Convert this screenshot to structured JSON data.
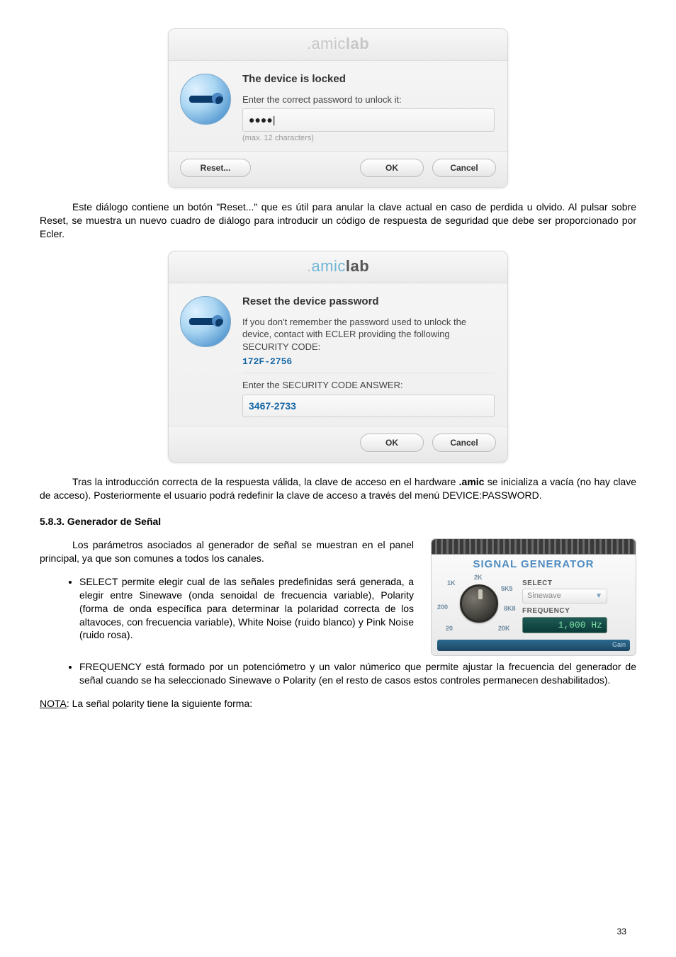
{
  "dialog1": {
    "brand_pre": ".",
    "brand_mid": "amic",
    "brand_post": "lab",
    "title": "The device is locked",
    "prompt": "Enter the correct password to unlock it:",
    "input_value": "●●●●|",
    "hint": "(max. 12 characters)",
    "reset_btn": "Reset...",
    "ok_btn": "OK",
    "cancel_btn": "Cancel"
  },
  "para1": "Este diálogo contiene un botón \"Reset...\" que es útil para anular la clave actual en caso de perdida u olvido. Al pulsar sobre Reset, se muestra un nuevo cuadro de diálogo para introducir un código de respuesta de seguridad que debe ser proporcionado por Ecler.",
  "dialog2": {
    "brand_pre": ".",
    "brand_mid": "amic",
    "brand_post": "lab",
    "title": "Reset the device password",
    "line1": "If you don't remember the password used to unlock the device, contact with ECLER providing the following SECURITY CODE:",
    "code1": "172F-2756",
    "line2": "Enter the SECURITY CODE ANSWER:",
    "code2": "3467-2733",
    "ok_btn": "OK",
    "cancel_btn": "Cancel"
  },
  "para2a": "Tras la introducción correcta de la respuesta válida, la clave de acceso en el hardware ",
  "para2b": ".amic",
  "para2c": " se inicializa a vacía (no hay clave de acceso). Posteriormente el usuario podrá redefinir la clave de acceso a través del menú DEVICE:PASSWORD.",
  "section_heading": "5.8.3. Generador de Señal",
  "para3": "Los parámetros asociados al generador de señal se muestran en el panel principal, ya que son comunes a todos los canales.",
  "bullets": {
    "b1": "SELECT permite elegir cual de las señales predefinidas será generada, a elegir entre Sinewave (onda senoidal de frecuencia variable), Polarity (forma de onda específica para determinar la polaridad correcta de los altavoces, con frecuencia variable), White Noise (ruido blanco) y Pink Noise (ruido rosa).",
    "b2": "FREQUENCY está formado por un potenciómetro y un valor númerico que permite ajustar la frecuencia del generador de señal cuando se ha seleccionado Sinewave o Polarity (en el resto de casos estos controles permanecen deshabilitados)."
  },
  "note_label": "NOTA",
  "note_text": ": La señal polarity tiene la siguiente forma:",
  "sg": {
    "title": "SIGNAL GENERATOR",
    "labels": {
      "k1": "1K",
      "k2": "2K",
      "k5": "5K5",
      "p200": "200",
      "k8": "8K8",
      "p20": "20",
      "k20": "20K"
    },
    "select_label": "SELECT",
    "select_value": "Sinewave",
    "freq_label": "FREQUENCY",
    "freq_value": "1,000 Hz",
    "footer_hint": "Gain"
  },
  "page_number": "33"
}
